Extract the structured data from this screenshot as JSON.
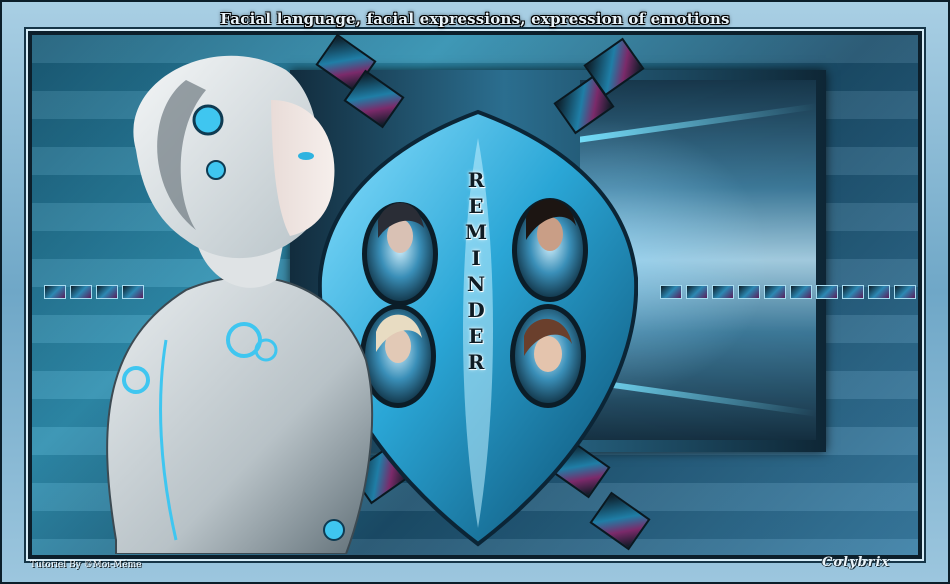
{
  "title": "Facial language, facial expressions, expression of emotions",
  "center_label_letters": [
    "R",
    "E",
    "M",
    "I",
    "N",
    "D",
    "E",
    "R"
  ],
  "credit": "Tutoriel By ©Moi-Même",
  "signature": "Colybrix",
  "colors": {
    "accent_cyan": "#3fc6f0",
    "frame_light": "#a9cfe4",
    "frame_dark": "#0c1f2b",
    "panel_blue": "#2f8fb0"
  }
}
